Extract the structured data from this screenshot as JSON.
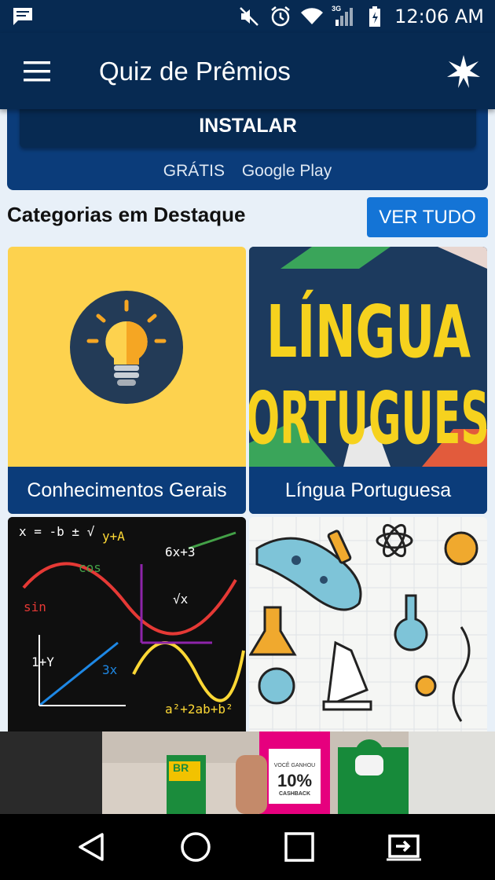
{
  "status_bar": {
    "time": "12:06 AM",
    "network_label": "3G",
    "icons": [
      "message-icon",
      "mute-icon",
      "alarm-icon",
      "wifi-icon",
      "signal-icon",
      "battery-icon"
    ]
  },
  "app_bar": {
    "title": "Quiz de Prêmios",
    "menu_icon": "hamburger-menu-icon",
    "action_icon": "sparkle-icon"
  },
  "install_card": {
    "button_label": "INSTALAR",
    "price": "GRÁTIS",
    "store": "Google Play"
  },
  "featured": {
    "title": "Categorias em Destaque",
    "see_all_label": "VER TUDO",
    "categories": [
      {
        "label": "Conhecimentos Gerais",
        "image_icon": "lightbulb-icon"
      },
      {
        "label": "Língua Portuguesa",
        "image_text_1": "LÍNGUA",
        "image_text_2": "ORTUGUES"
      },
      {
        "label": "",
        "image_icon": "math-formulas-image",
        "formulas": [
          "x = -b ± √",
          "y+A",
          "6x+3",
          "sin",
          "cos",
          "√x",
          "3x",
          "1+Y",
          "a²+2ab+b²"
        ]
      },
      {
        "label": "",
        "image_icon": "science-illustration-image"
      }
    ]
  },
  "ad_banner": {
    "badge_top": "VOCÊ GANHOU",
    "badge_value": "10%",
    "badge_bottom": "CASHBACK",
    "brand": "BR"
  },
  "nav_bar": {
    "icons": [
      "back-icon",
      "home-icon",
      "recents-icon",
      "screen-cast-icon"
    ]
  },
  "colors": {
    "primary_dark": "#072a52",
    "primary": "#0b3c7a",
    "accent": "#1474d6",
    "tile_yellow": "#fdd24e",
    "background": "#e8f0f8"
  }
}
